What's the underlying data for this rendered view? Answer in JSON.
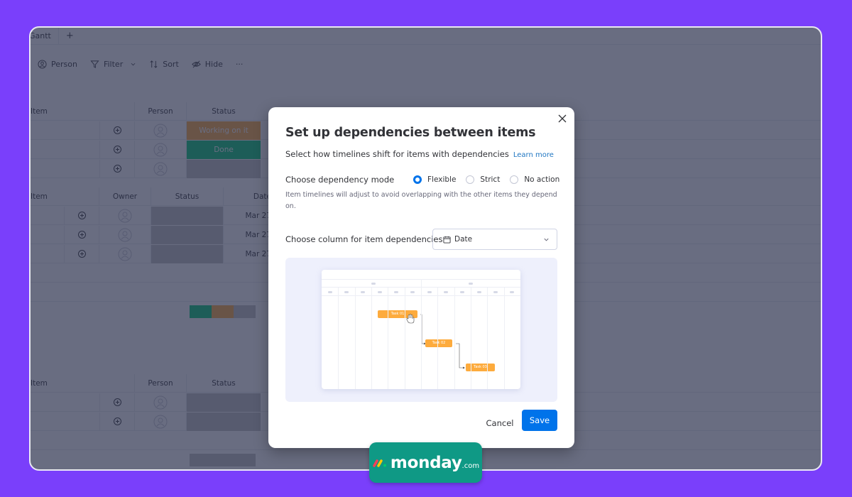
{
  "app": {
    "tab": "Gantt",
    "tab_add": "+",
    "toolbar": {
      "person": "Person",
      "filter": "Filter",
      "sort": "Sort",
      "hide": "Hide",
      "more": "···"
    },
    "groups": [
      {
        "headers": {
          "item": "Item",
          "person": "Person",
          "status": "Status"
        },
        "rows": [
          {
            "status": "Working on it",
            "status_color": "#fdab3d"
          },
          {
            "status": "Done",
            "status_color": "#00c875"
          },
          {
            "status": "",
            "status_color": "#c4c4c4"
          }
        ]
      },
      {
        "headers": {
          "item": "Item",
          "owner": "Owner",
          "status": "Status",
          "date": "Date"
        },
        "rows": [
          {
            "status": "",
            "date": "Mar 27"
          },
          {
            "status": "",
            "date": "Mar 27"
          },
          {
            "status": "",
            "date": "Mar 27"
          }
        ],
        "summary_colors": [
          "#00c875",
          "#fdab3d",
          "#c4c4c4"
        ]
      },
      {
        "headers": {
          "item": "Item",
          "person": "Person",
          "status": "Status"
        },
        "rows": [
          {
            "status": ""
          },
          {
            "status": ""
          }
        ]
      }
    ]
  },
  "modal": {
    "title": "Set up dependencies between items",
    "subtitle": "Select how timelines shift for items with dependencies",
    "learn_more": "Learn more",
    "mode_label": "Choose dependency mode",
    "modes": [
      {
        "label": "Flexible",
        "checked": true
      },
      {
        "label": "Strict",
        "checked": false
      },
      {
        "label": "No action",
        "checked": false
      }
    ],
    "mode_description": "Item timelines will adjust to avoid overlapping with the other items they depend on.",
    "column_label": "Choose column for item dependencies",
    "column_value": "Date",
    "preview_tasks": [
      "Task 01",
      "Task 02",
      "Task 03"
    ],
    "cancel": "Cancel",
    "save": "Save"
  },
  "brand": {
    "name": "monday",
    "suffix": ".com"
  },
  "colors": {
    "accent": "#0073ea",
    "background": "#7a3ffb",
    "brand_badge": "#0f9985",
    "task_bar": "#fdab3d"
  }
}
